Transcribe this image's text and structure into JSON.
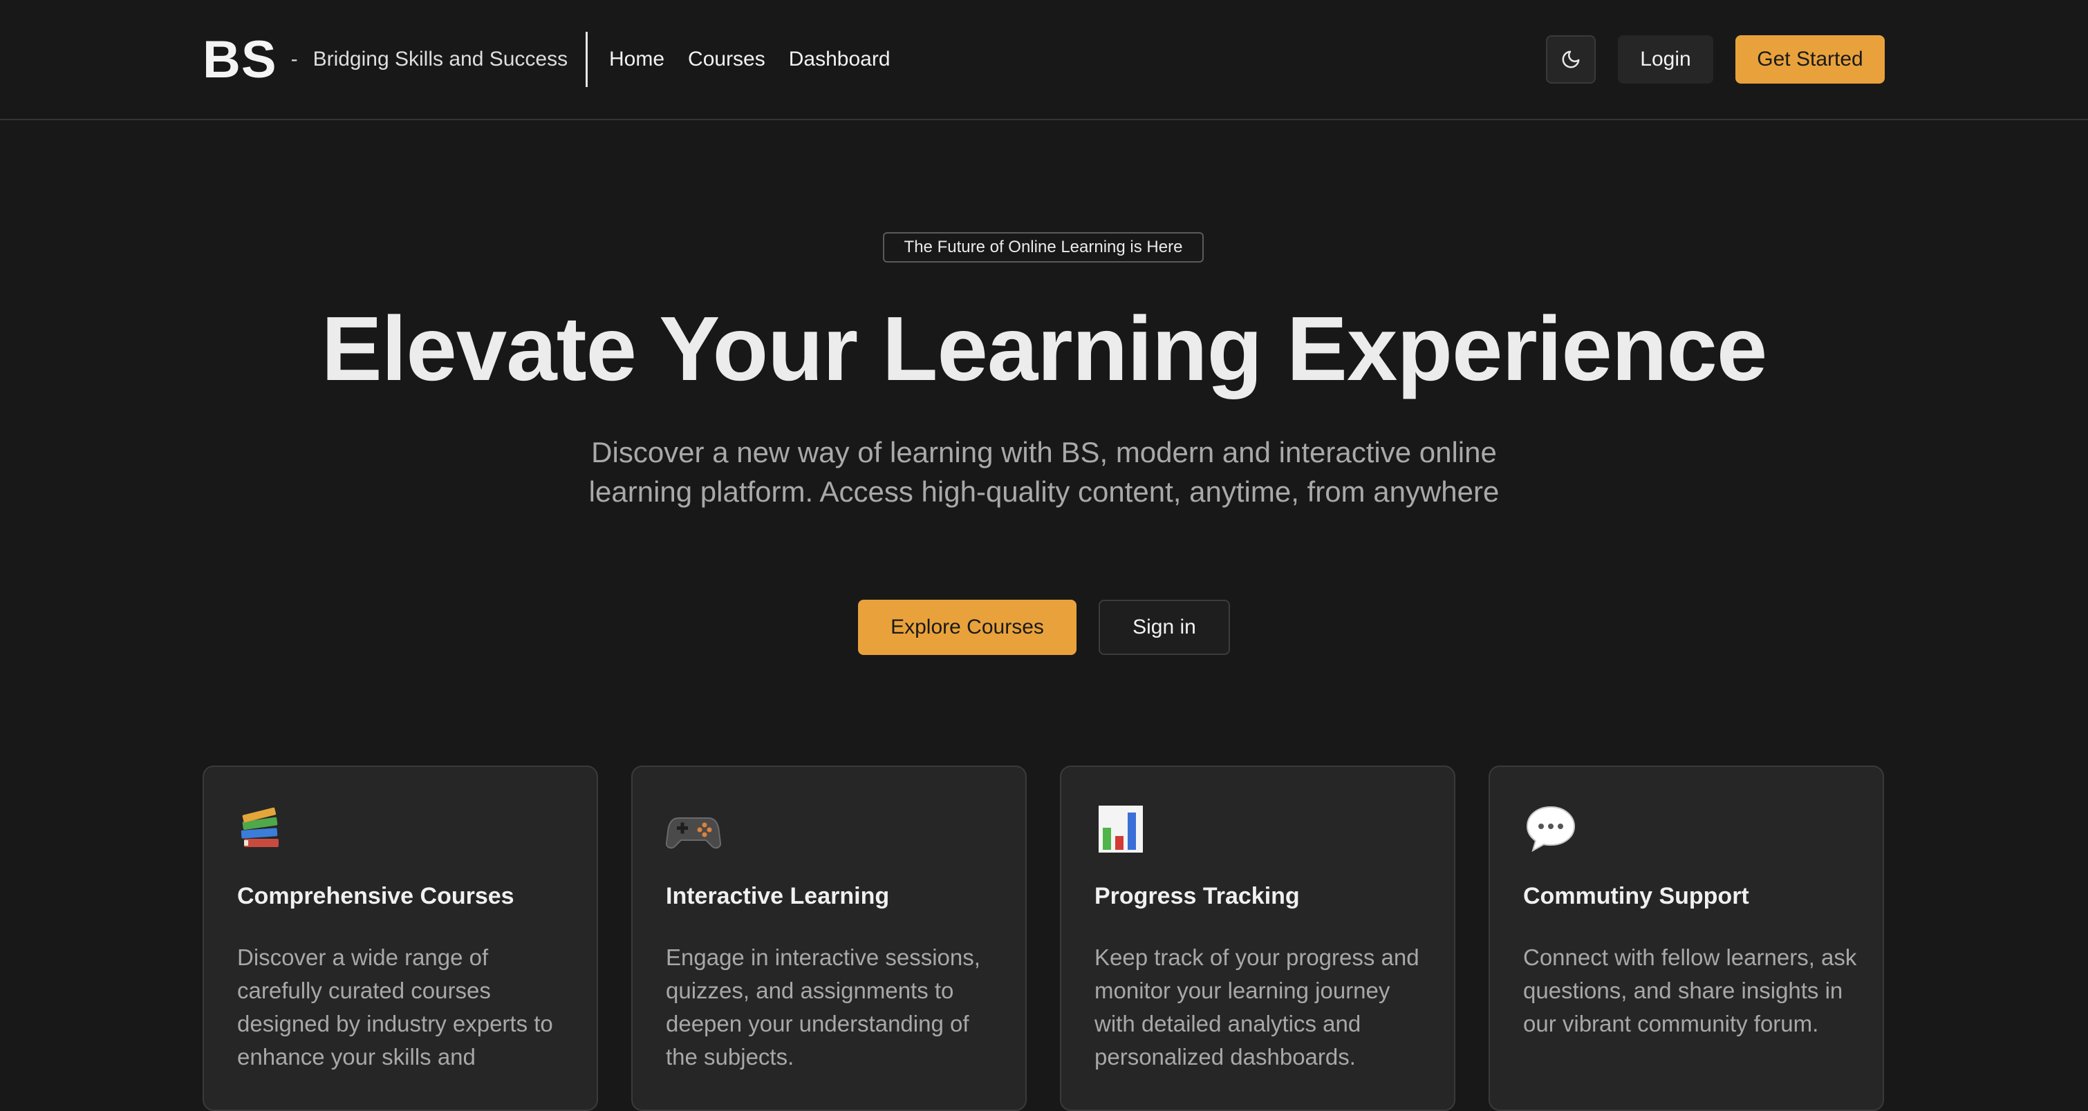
{
  "header": {
    "logo": "BS",
    "separator": "-",
    "tagline": "Bridging Skills and Success",
    "nav": [
      "Home",
      "Courses",
      "Dashboard"
    ],
    "theme_icon": "moon-icon",
    "login_label": "Login",
    "get_started_label": "Get Started"
  },
  "hero": {
    "badge": "The Future of Online Learning is Here",
    "title": "Elevate Your Learning Experience",
    "subtitle_line1": "Discover a new way of learning with BS, modern and interactive online",
    "subtitle_line2": "learning platform. Access high-quality content, anytime, from anywhere",
    "explore_label": "Explore Courses",
    "signin_label": "Sign in"
  },
  "features": [
    {
      "icon": "books-icon",
      "title": "Comprehensive Courses",
      "text": "Discover a wide range of carefully curated courses designed by industry experts to enhance your skills and"
    },
    {
      "icon": "gamepad-icon",
      "title": "Interactive Learning",
      "text": "Engage in interactive sessions, quizzes, and assignments to deepen your understanding of the subjects."
    },
    {
      "icon": "bar-chart-icon",
      "title": "Progress Tracking",
      "text": "Keep track of your progress and monitor your learning journey with detailed analytics and personalized dashboards."
    },
    {
      "icon": "speech-bubble-icon",
      "title": "Commutiny Support",
      "text": "Connect with fellow learners, ask questions, and share insights in our vibrant community forum."
    }
  ],
  "colors": {
    "accent": "#e9a23b",
    "background": "#181818",
    "card": "#262626"
  }
}
